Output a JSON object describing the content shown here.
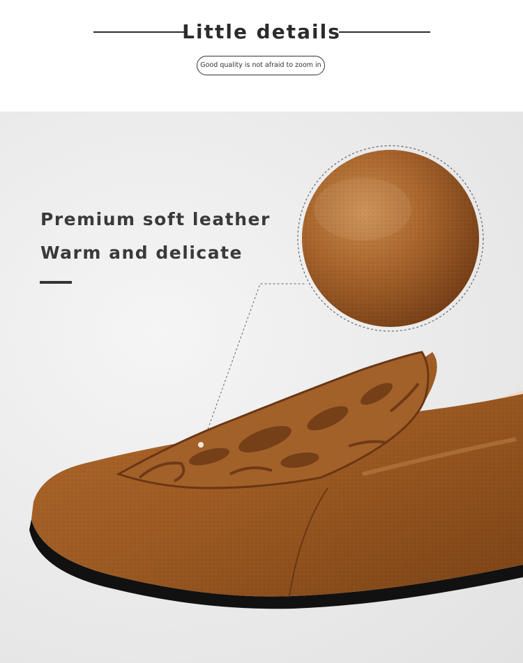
{
  "header": {
    "title": "Little details",
    "subtitle": "Good quality is not afraid to zoom in"
  },
  "feature": {
    "line1": "Premium soft leather",
    "line2": "Warm and delicate"
  },
  "colors": {
    "leather": "#9a5a26",
    "leather_dark": "#6e3a15",
    "leather_light": "#c27b3a",
    "sole": "#111111",
    "background": "#e9e9e9"
  }
}
